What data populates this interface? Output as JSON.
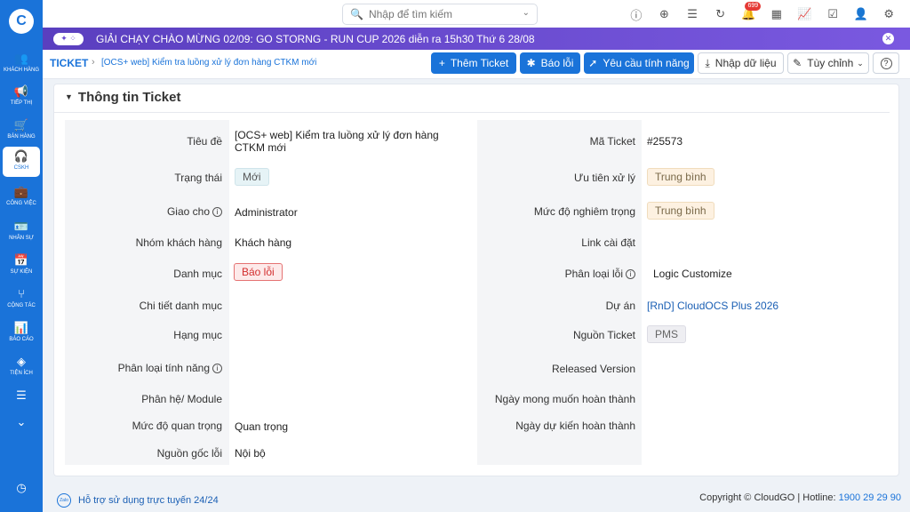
{
  "sidebar": {
    "logo": "C",
    "items": [
      {
        "label": "Khách hàng",
        "icon": "users-icon",
        "glyph": "👥"
      },
      {
        "label": "Tiếp thị",
        "icon": "megaphone-icon",
        "glyph": "📢"
      },
      {
        "label": "Bán hàng",
        "icon": "cart-icon",
        "glyph": "🛒"
      },
      {
        "label": "CSKH",
        "icon": "headset-icon",
        "glyph": "🎧"
      },
      {
        "label": "Công việc",
        "icon": "briefcase-icon",
        "glyph": "💼"
      },
      {
        "label": "Nhân sự",
        "icon": "id-card-icon",
        "glyph": "🪪"
      },
      {
        "label": "Sự kiện",
        "icon": "calendar-icon",
        "glyph": "📅"
      },
      {
        "label": "Cộng tác",
        "icon": "share-icon",
        "glyph": "⑂"
      },
      {
        "label": "Báo cáo",
        "icon": "report-icon",
        "glyph": "📊"
      },
      {
        "label": "Tiện ích",
        "icon": "layers-icon",
        "glyph": "◈"
      },
      {
        "label": "",
        "icon": "list-icon",
        "glyph": "☰"
      },
      {
        "label": "",
        "icon": "chevron-down-icon",
        "glyph": "⌄"
      }
    ],
    "bottom_glyph": "◷"
  },
  "search": {
    "placeholder": "Nhập để tìm kiếm"
  },
  "top_icons": [
    {
      "name": "info-icon",
      "glyph": "ⓘ"
    },
    {
      "name": "add-circle-icon",
      "glyph": "⊕"
    },
    {
      "name": "list-icon",
      "glyph": "☰"
    },
    {
      "name": "refresh-icon",
      "glyph": "↻"
    },
    {
      "name": "bell-icon",
      "glyph": "🔔",
      "badge": "699"
    },
    {
      "name": "calendar-icon",
      "glyph": "▦"
    },
    {
      "name": "chart-icon",
      "glyph": "📈"
    },
    {
      "name": "checkbox-icon",
      "glyph": "☑"
    },
    {
      "name": "user-icon",
      "glyph": "👤"
    },
    {
      "name": "settings-icon",
      "glyph": "⚙"
    }
  ],
  "banner": {
    "icon_glyph": "✦ ⁘",
    "text": "GIẢI CHẠY CHÀO MỪNG 02/09: GO STORNG - RUN CUP 2026 diễn ra 15h30 Thứ 6 28/08",
    "close_glyph": "✕"
  },
  "breadcrumb": {
    "root": "TICKET",
    "sep": "›",
    "title": "[OCS+ web] Kiểm tra luồng xử lý đơn hàng CTKM mới"
  },
  "toolbar": {
    "add_ticket": "Thêm Ticket",
    "bug_report": "Báo lỗi",
    "feature_request": "Yêu cầu tính năng",
    "import_data": "Nhập dữ liệu",
    "customize": "Tùy chỉnh",
    "help": "?"
  },
  "section": {
    "title": "Thông tin Ticket"
  },
  "fields_left": {
    "title_label": "Tiêu đề",
    "title_value": "[OCS+ web] Kiểm tra luồng xử lý đơn hàng CTKM mới",
    "status_label": "Trạng thái",
    "status_value": "Mới",
    "assign_label": "Giao cho",
    "assign_value": "Administrator",
    "group_label": "Nhóm khách hàng",
    "group_value": "Khách hàng",
    "category_label": "Danh mục",
    "category_value": "Báo lỗi",
    "category_detail_label": "Chi tiết danh mục",
    "category_detail_value": "",
    "item_label": "Hạng mục",
    "item_value": "",
    "feature_type_label": "Phân loại tính năng",
    "feature_type_value": "",
    "module_label": "Phân hệ/ Module",
    "module_value": "",
    "importance_label": "Mức độ quan trọng",
    "importance_value": "Quan trọng",
    "origin_label": "Nguồn gốc lỗi",
    "origin_value": "Nội bộ"
  },
  "fields_right": {
    "ticket_id_label": "Mã Ticket",
    "ticket_id_value": "#25573",
    "priority_label": "Ưu tiên xử lý",
    "priority_value": "Trung bình",
    "severity_label": "Mức độ nghiêm trọng",
    "severity_value": "Trung bình",
    "install_link_label": "Link cài đặt",
    "install_link_value": "",
    "error_type_label": "Phân loại lỗi",
    "error_type_value": "Logic Customize",
    "project_label": "Dự án",
    "project_value": "[RnD] CloudOCS Plus 2026",
    "source_label": "Nguồn Ticket",
    "source_value": "PMS",
    "released_label": "Released Version",
    "released_value": "",
    "desired_date_label": "Ngày mong muốn hoàn thành",
    "desired_date_value": "",
    "expected_date_label": "Ngày dự kiến hoàn thành",
    "expected_date_value": ""
  },
  "footer": {
    "zalo": "Zalo",
    "support": "Hỗ trợ sử dụng trực tuyến 24/24",
    "copyright": "Copyright © CloudGO | Hotline: ",
    "hotline": "1900 29 29 90"
  }
}
